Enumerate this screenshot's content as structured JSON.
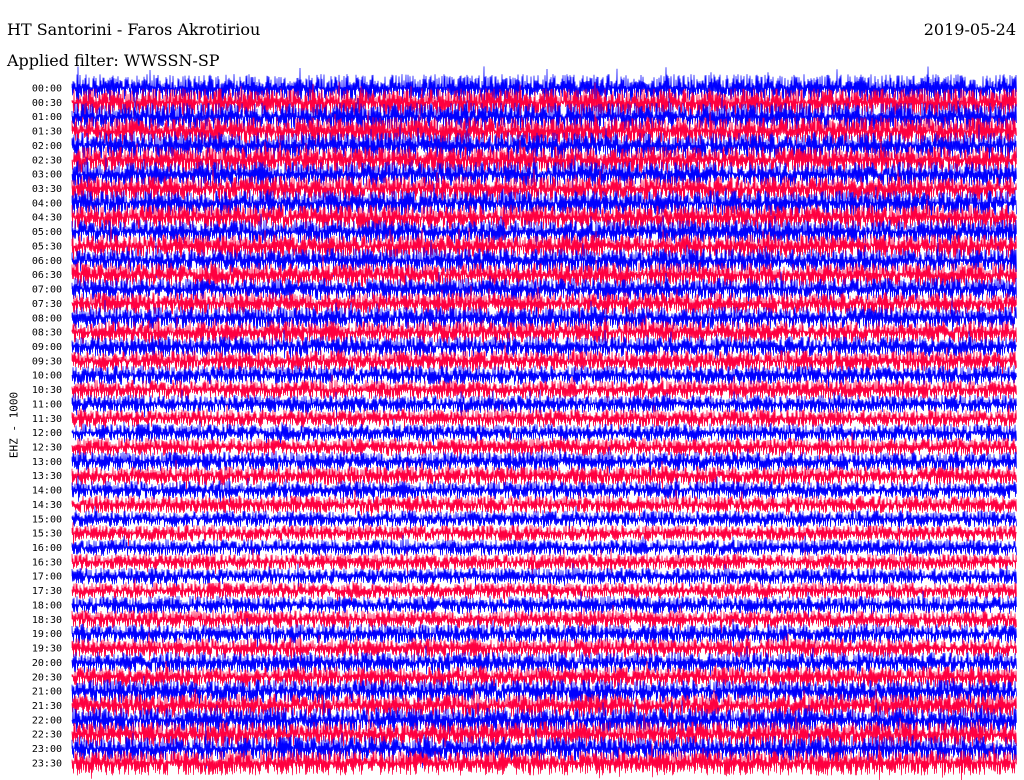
{
  "header": {
    "title": "HT Santorini - Faros Akrotiriou",
    "date": "2019-05-24",
    "filter_label": "Applied filter: WWSSN-SP"
  },
  "colors": {
    "series_a": "#0000ff",
    "series_b": "#ff0040",
    "background": "#ffffff",
    "text": "#000000"
  },
  "chart_data": {
    "type": "line",
    "ylabel": "EHZ - 1000",
    "row_labels": [
      "00:00",
      "00:30",
      "01:00",
      "01:30",
      "02:00",
      "02:30",
      "03:00",
      "03:30",
      "04:00",
      "04:30",
      "05:00",
      "05:30",
      "06:00",
      "06:30",
      "07:00",
      "07:30",
      "08:00",
      "08:30",
      "09:00",
      "09:30",
      "10:00",
      "10:30",
      "11:00",
      "11:30",
      "12:00",
      "12:30",
      "13:00",
      "13:30",
      "14:00",
      "14:30",
      "15:00",
      "15:30",
      "16:00",
      "16:30",
      "17:00",
      "17:30",
      "18:00",
      "18:30",
      "19:00",
      "19:30",
      "20:00",
      "20:30",
      "21:00",
      "21:30",
      "22:00",
      "22:30",
      "23:00",
      "23:30"
    ],
    "trace_colors": [
      "#0000ff",
      "#ff0040"
    ],
    "color_pattern": "alternating",
    "relative_amplitude": [
      1.0,
      1.0,
      1.0,
      1.0,
      0.95,
      0.95,
      0.9,
      0.9,
      0.9,
      0.9,
      0.85,
      0.85,
      0.85,
      0.85,
      0.8,
      0.8,
      0.8,
      0.8,
      0.75,
      0.75,
      0.7,
      0.7,
      0.65,
      0.65,
      0.65,
      0.65,
      0.7,
      0.7,
      0.65,
      0.65,
      0.6,
      0.6,
      0.6,
      0.6,
      0.6,
      0.6,
      0.65,
      0.65,
      0.7,
      0.7,
      0.75,
      0.75,
      0.85,
      0.85,
      0.9,
      0.9,
      0.9,
      0.9
    ],
    "grid": false,
    "legend": "none"
  }
}
